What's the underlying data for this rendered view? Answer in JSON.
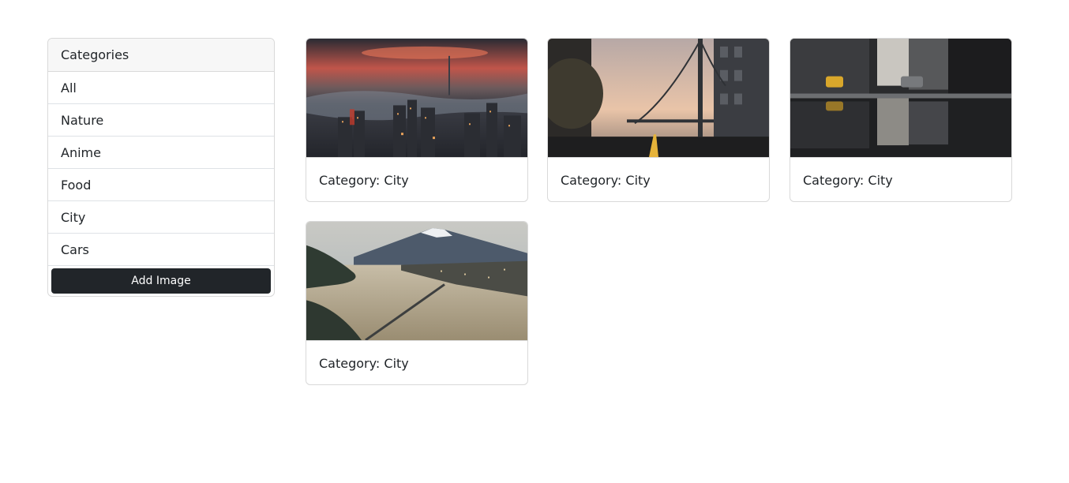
{
  "sidebar": {
    "header": "Categories",
    "items": [
      "All",
      "Nature",
      "Anime",
      "Food",
      "City",
      "Cars"
    ],
    "add_button_label": "Add Image"
  },
  "cards": [
    {
      "caption": "Category: City",
      "image": "city-night-aerial-photo"
    },
    {
      "caption": "Category: City",
      "image": "bridge-street-sunset-photo"
    },
    {
      "caption": "Category: City",
      "image": "street-reflection-photo"
    },
    {
      "caption": "Category: City",
      "image": "mountain-lake-city-photo"
    }
  ],
  "colors": {
    "button_bg": "#212529",
    "border": "#d9d9d9",
    "header_bg": "#f7f7f7"
  }
}
